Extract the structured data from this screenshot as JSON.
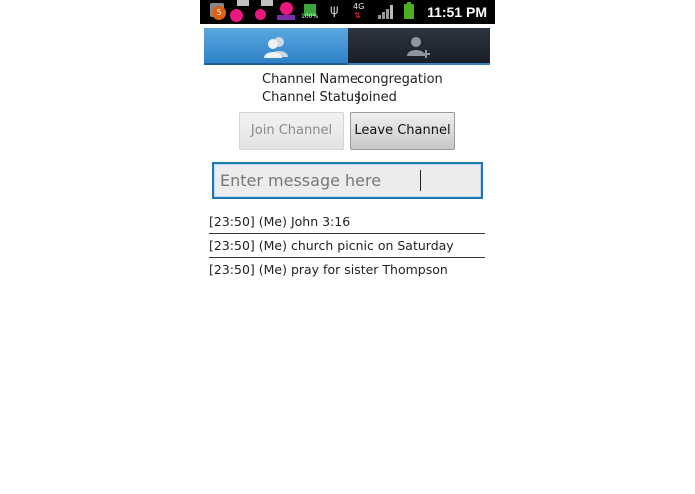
{
  "status_bar": {
    "time": "11:51 PM",
    "notification_count": "5",
    "battery_percent": "100%",
    "network": "4G",
    "colors": {
      "background": "#000000",
      "notification": "#e8187f",
      "battery": "#4caf1e"
    },
    "icons": [
      "notification-icon",
      "usb-icon",
      "signal-icon",
      "battery-icon"
    ]
  },
  "tabs": [
    {
      "icon": "contacts-icon",
      "active": true
    },
    {
      "icon": "add-contact-icon",
      "active": false
    }
  ],
  "channel": {
    "name_label": "Channel Name:",
    "name_value": "congregation",
    "status_label": "Channel Status:",
    "status_value": "Joined"
  },
  "buttons": {
    "join_label": "Join Channel",
    "leave_label": "Leave Channel"
  },
  "message_input": {
    "placeholder": "Enter message here",
    "value": ""
  },
  "messages": [
    "[23:50] (Me) John 3:16",
    "[23:50] (Me) church picnic on Saturday",
    "[23:50] (Me) pray for sister Thompson"
  ],
  "colors": {
    "accent": "#1f77b4",
    "tab_active": "#2f82c8",
    "tab_inactive": "#1a1f27"
  }
}
